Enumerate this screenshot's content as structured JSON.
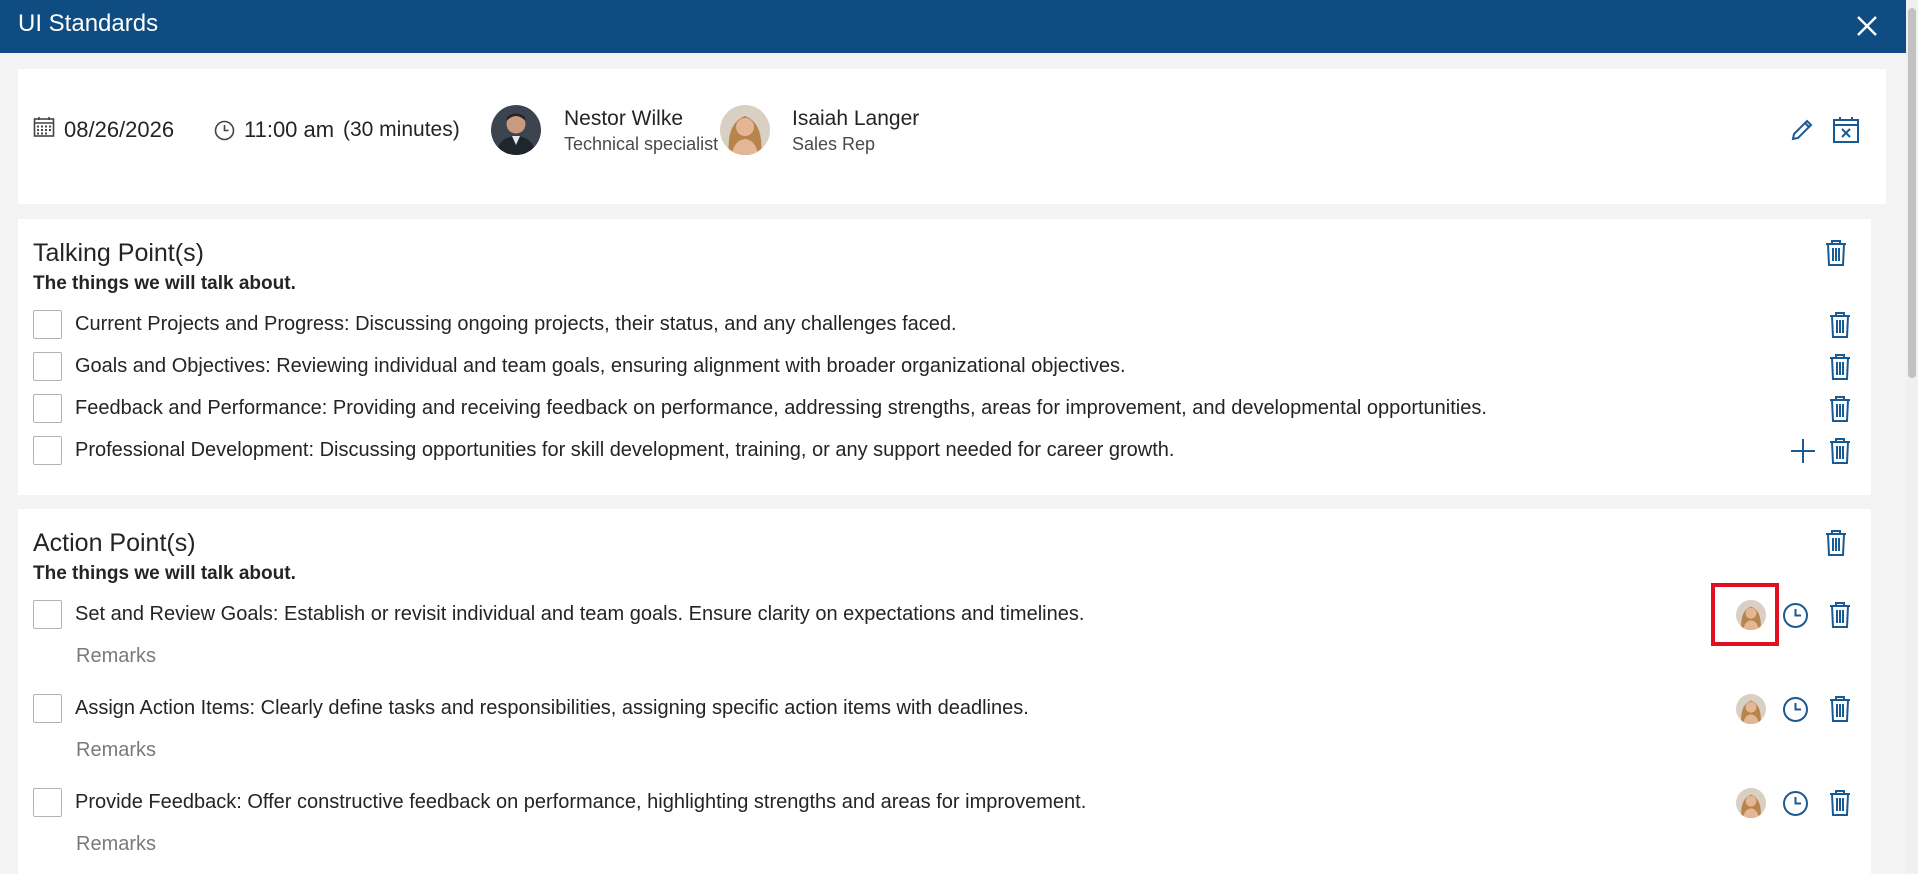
{
  "window": {
    "title": "UI Standards",
    "close_icon": "close-icon"
  },
  "colors": {
    "header": "#0f4c81",
    "accent": "#1a5a94",
    "highlight": "#e01020"
  },
  "meeting": {
    "date": "08/26/2026",
    "time": "11:00 am",
    "duration": "(30 minutes)",
    "participants": [
      {
        "name": "Nestor Wilke",
        "role": "Technical specialist"
      },
      {
        "name": "Isaiah Langer",
        "role": "Sales Rep"
      }
    ]
  },
  "talking_points": {
    "title": "Talking Point(s)",
    "subtitle": "The things we will talk about.",
    "items": [
      {
        "text": "Current Projects and Progress: Discussing ongoing projects, their status, and any challenges faced."
      },
      {
        "text": "Goals and Objectives: Reviewing individual and team goals, ensuring alignment with broader organizational objectives."
      },
      {
        "text": "Feedback and Performance: Providing and receiving feedback on performance, addressing strengths, areas for improvement, and developmental opportunities."
      },
      {
        "text": "Professional Development: Discussing opportunities for skill development, training, or any support needed for career growth."
      }
    ]
  },
  "action_points": {
    "title": "Action Point(s)",
    "subtitle": "The things we will talk about.",
    "remarks_placeholder": "Remarks",
    "items": [
      {
        "text": "Set and Review Goals: Establish or revisit individual and team goals. Ensure clarity on expectations and timelines.",
        "remarks": "Remarks"
      },
      {
        "text": "Assign Action Items: Clearly define tasks and responsibilities, assigning specific action items with deadlines.",
        "remarks": "Remarks"
      },
      {
        "text": "Provide Feedback: Offer constructive feedback on performance, highlighting strengths and areas for improvement.",
        "remarks": "Remarks"
      }
    ]
  }
}
